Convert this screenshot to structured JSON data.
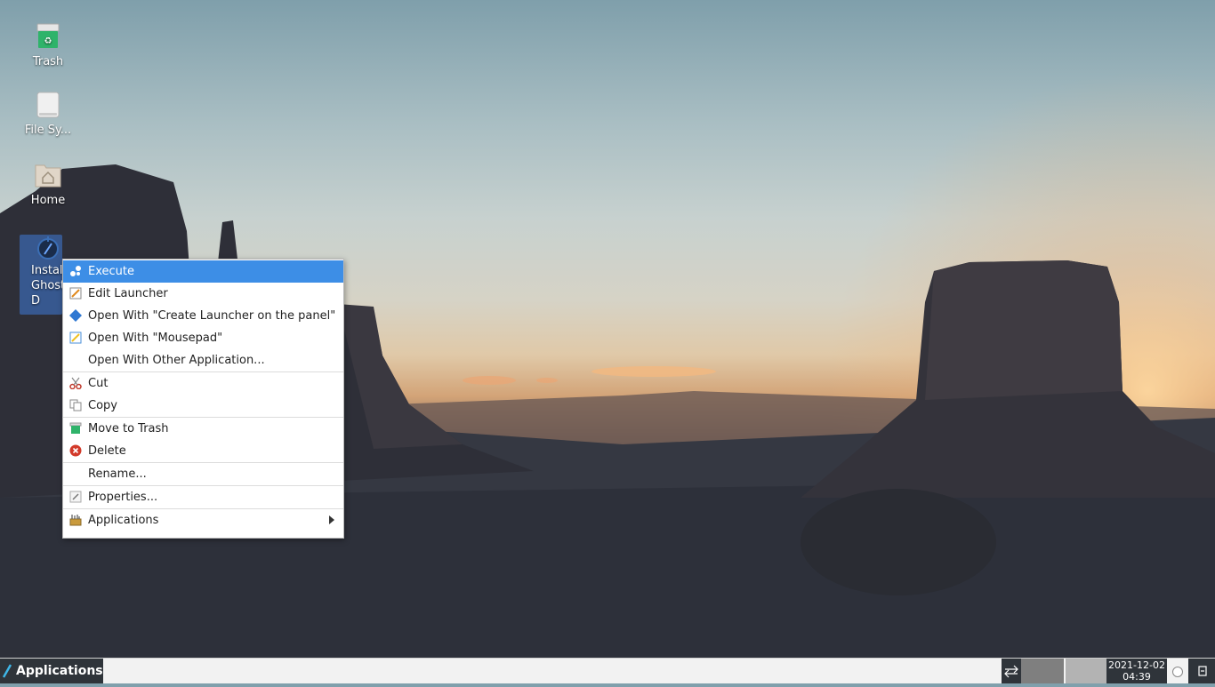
{
  "desktop": {
    "icons": [
      {
        "label": "Trash",
        "icon": "trash-icon"
      },
      {
        "label": "File Sy...",
        "icon": "drive-icon"
      },
      {
        "label": "Home",
        "icon": "home-folder-icon"
      },
      {
        "label": "Instal\nGhostE\nD",
        "icon": "launcher-icon"
      }
    ]
  },
  "context_menu": {
    "items": [
      {
        "label": "Execute",
        "icon": "execute-icon"
      },
      {
        "label": "Edit Launcher",
        "icon": "edit-icon"
      },
      {
        "label": "Open With \"Create Launcher on the panel\"",
        "icon": "launcher-diamond-icon"
      },
      {
        "label": "Open With \"Mousepad\"",
        "icon": "mousepad-icon"
      },
      {
        "label": "Open With Other Application...",
        "icon": ""
      },
      {
        "label": "Cut",
        "icon": "scissors-icon"
      },
      {
        "label": "Copy",
        "icon": "copy-icon"
      },
      {
        "label": "Move to Trash",
        "icon": "trash-icon"
      },
      {
        "label": "Delete",
        "icon": "delete-icon"
      },
      {
        "label": "Rename...",
        "icon": ""
      },
      {
        "label": "Properties...",
        "icon": "properties-icon"
      },
      {
        "label": "Applications",
        "icon": "applications-icon"
      }
    ]
  },
  "taskbar": {
    "applications_label": "Applications",
    "date": "2021-12-02",
    "time": "04:39"
  }
}
